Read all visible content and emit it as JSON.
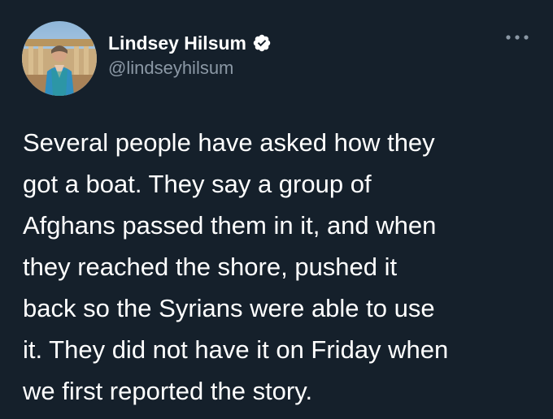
{
  "theme": {
    "background": "#15202b",
    "text_primary": "#ffffff",
    "text_secondary": "#8b98a5",
    "verified_badge": "#ffffff"
  },
  "tweet": {
    "author": {
      "display_name": "Lindsey Hilsum",
      "handle": "@lindseyhilsum",
      "verified": true,
      "avatar_icon": "profile-photo"
    },
    "more_icon": "ellipsis-icon",
    "text": "Several people have asked how they\ngot a boat. They say a group of\nAfghans passed them in it, and when\nthey reached the shore, pushed it\nback so the Syrians were able to use\nit. They did not have it on Friday when\nwe first reported the story."
  }
}
